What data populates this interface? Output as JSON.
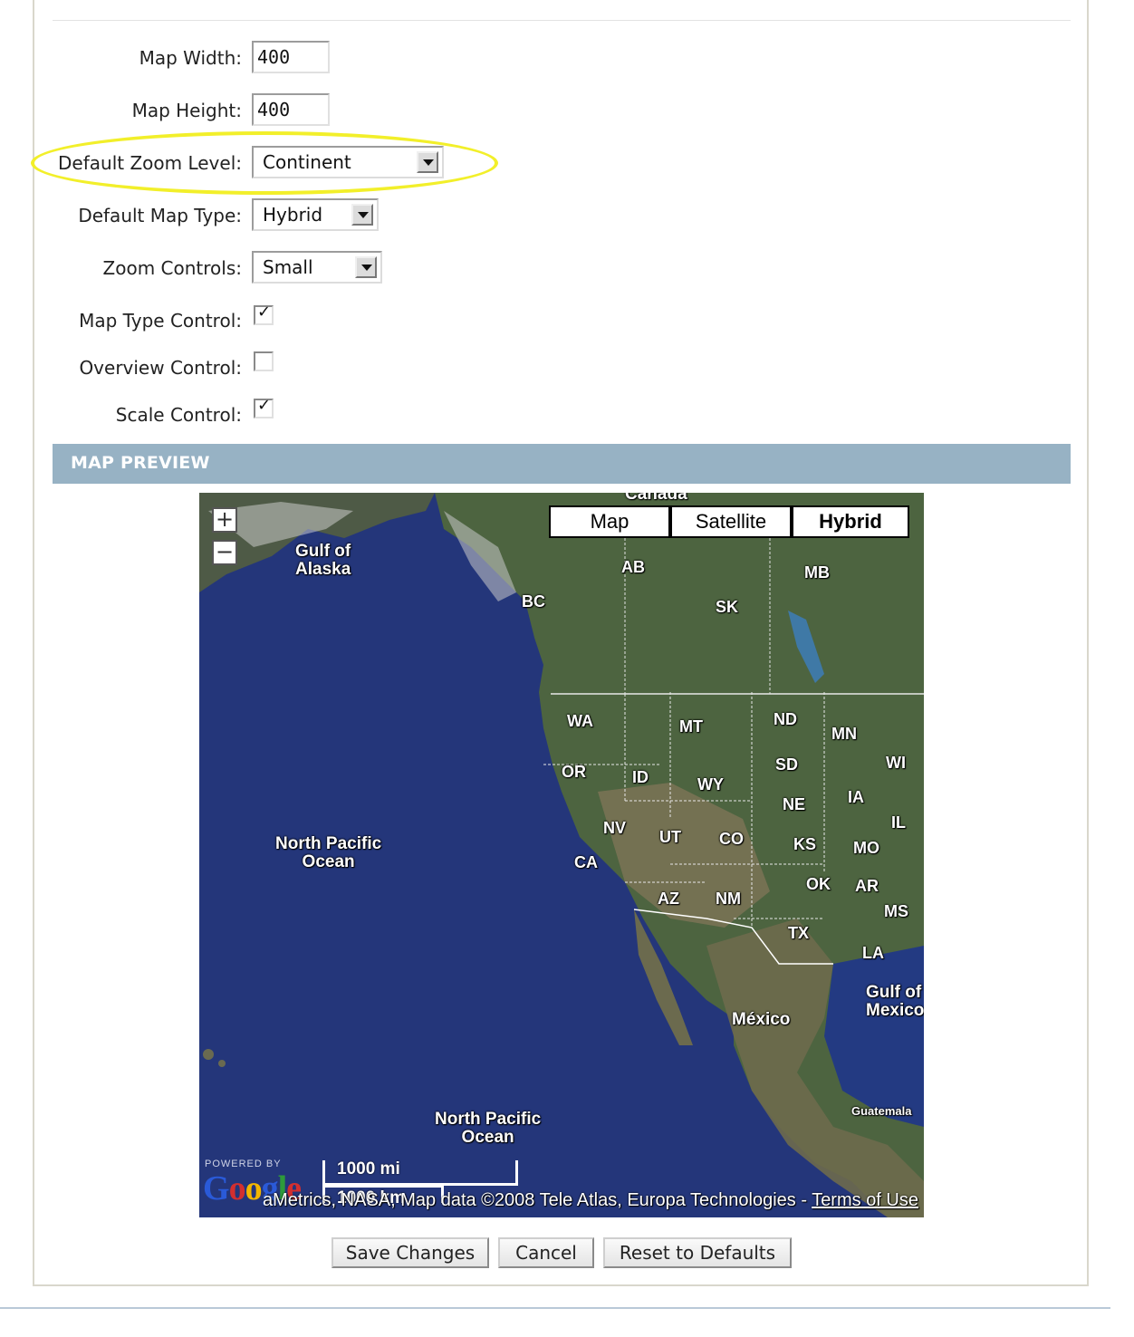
{
  "form": {
    "map_width_label": "Map Width:",
    "map_width_value": "400",
    "map_height_label": "Map Height:",
    "map_height_value": "400",
    "zoom_level_label": "Default Zoom Level:",
    "zoom_level_value": "Continent",
    "map_type_label": "Default Map Type:",
    "map_type_value": "Hybrid",
    "zoom_controls_label": "Zoom Controls:",
    "zoom_controls_value": "Small",
    "map_type_control_label": "Map Type Control:",
    "map_type_control_checked": true,
    "overview_control_label": "Overview Control:",
    "overview_control_checked": false,
    "scale_control_label": "Scale Control:",
    "scale_control_checked": true,
    "highlight_color": "#f2ef2a"
  },
  "preview": {
    "section_title": "MAP PREVIEW",
    "map_type_buttons": [
      "Map",
      "Satellite",
      "Hybrid"
    ],
    "active_map_type": "Hybrid",
    "zoom_in": "+",
    "zoom_out": "−",
    "labels": {
      "canada": "Canada",
      "gulf_alaska_1": "Gulf of",
      "gulf_alaska_2": "Alaska",
      "ab": "AB",
      "bc": "BC",
      "sk": "SK",
      "mb": "MB",
      "wa": "WA",
      "mt": "MT",
      "nd": "ND",
      "mn": "MN",
      "wi": "WI",
      "or": "OR",
      "id": "ID",
      "wy": "WY",
      "sd": "SD",
      "ia": "IA",
      "ne": "NE",
      "il": "IL",
      "nv": "NV",
      "ut": "UT",
      "co": "CO",
      "ks": "KS",
      "mo": "MO",
      "ca": "CA",
      "ok": "OK",
      "ar": "AR",
      "az": "AZ",
      "nm": "NM",
      "ms": "MS",
      "tx": "TX",
      "la": "LA",
      "npo1_1": "North Pacific",
      "npo1_2": "Ocean",
      "npo2_1": "North Pacific",
      "npo2_2": "Ocean",
      "gulf_mexico_1": "Gulf of",
      "gulf_mexico_2": "Mexico",
      "mexico": "México",
      "guatemala": "Guatemala"
    },
    "powered_by": "POWERED BY",
    "google": "Google",
    "scale_mi": "1000 mi",
    "scale_km": "1000 km",
    "attribution": "aMetrics, NASA, Map data ©2008 Tele Atlas, Europa Technologies - ",
    "terms": "Terms of Use"
  },
  "buttons": {
    "save": "Save Changes",
    "cancel": "Cancel",
    "reset": "Reset to Defaults"
  }
}
